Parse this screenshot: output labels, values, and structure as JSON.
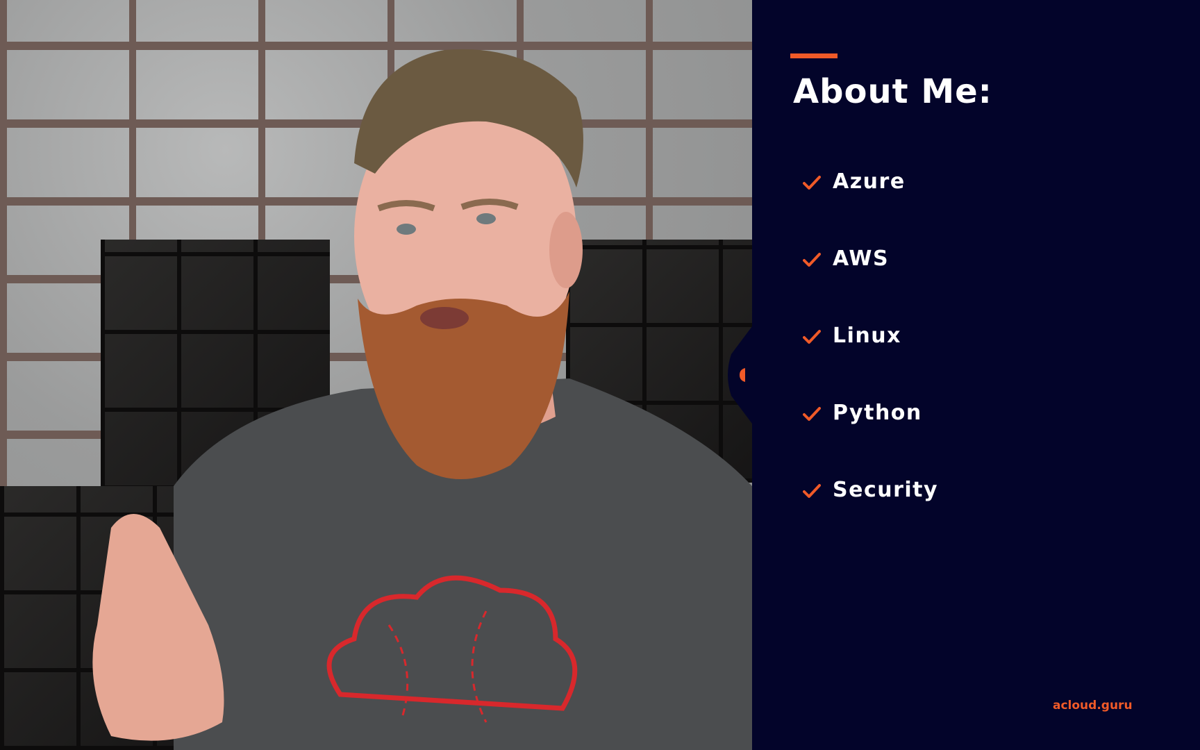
{
  "slide": {
    "heading": "About Me:",
    "items": [
      {
        "label": "Azure",
        "icon": "check-icon"
      },
      {
        "label": "AWS",
        "icon": "check-icon"
      },
      {
        "label": "Linux",
        "icon": "check-icon"
      },
      {
        "label": "Python",
        "icon": "check-icon"
      },
      {
        "label": "Security",
        "icon": "check-icon"
      }
    ],
    "brand": "acloud.guru"
  },
  "colors": {
    "panel_background": "#03042a",
    "accent": "#f05a28",
    "text": "#ffffff"
  }
}
